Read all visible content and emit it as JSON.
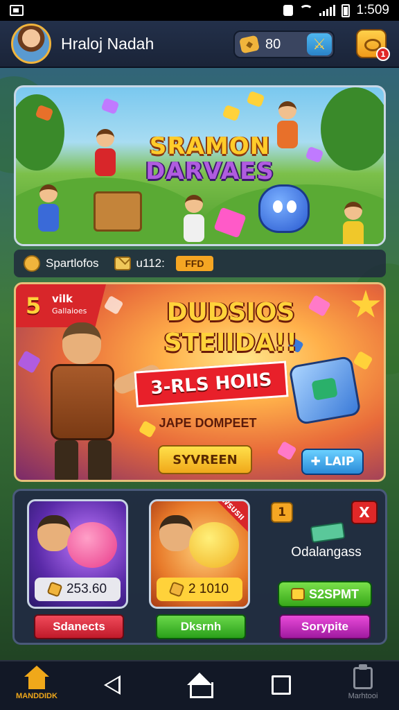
{
  "status_bar": {
    "time": "1:509"
  },
  "header": {
    "player_name": "Hraloj Nadah",
    "coins": "80",
    "notification_count": "1"
  },
  "hero_card": {
    "logo_line1": "SRAMON",
    "logo_line2": "DARVAES"
  },
  "info_row": {
    "label": "Spartlofos",
    "value": "u112:",
    "pill": "FFD"
  },
  "promo": {
    "ribbon_number": "5",
    "ribbon_title": "vilk",
    "ribbon_sub": "Gallaioes",
    "title_line1": "DUDSIOS",
    "title_line2": "STEIIDA!!",
    "ribbon_text": "3-RLS HOIIS",
    "subtitle": "JAPE DOMPEET",
    "primary_button": "SYVREEN",
    "secondary_button": "LAIP"
  },
  "shop": {
    "tile1": {
      "price": "253.60",
      "button": "Sdanects"
    },
    "tile2": {
      "corner": "WSUSII",
      "price": "2 1010",
      "button": "Dksrnh"
    },
    "exchange": {
      "badge": "1",
      "close": "X",
      "label": "Odalangass",
      "start_button": "S2SPMT",
      "bottom_button": "Sorypite"
    }
  },
  "navbar": {
    "home_label": "MANDDIDK",
    "match_label": "Marhtooi"
  },
  "colors": {
    "accent": "#f0a81a",
    "header_bg": "#1a2438",
    "red": "#e02828"
  }
}
